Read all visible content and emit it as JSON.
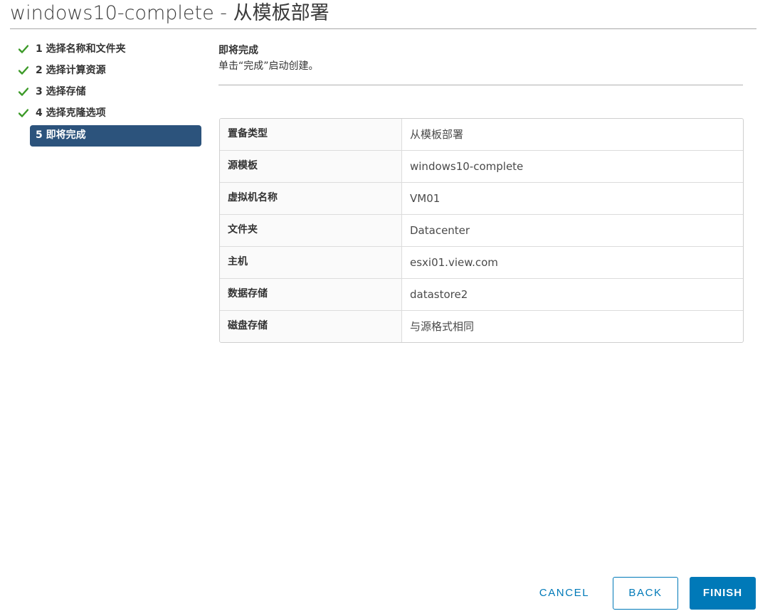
{
  "dialog": {
    "title": "windows10-complete - 从模板部署"
  },
  "steps": [
    {
      "label": "1 选择名称和文件夹",
      "completed": true,
      "icon": "checkmark-icon"
    },
    {
      "label": "2 选择计算资源",
      "completed": true,
      "icon": "checkmark-icon"
    },
    {
      "label": "3 选择存储",
      "completed": true,
      "icon": "checkmark-icon"
    },
    {
      "label": "4 选择克隆选项",
      "completed": true,
      "icon": "checkmark-icon"
    },
    {
      "label": "5 即将完成",
      "completed": false,
      "active": true
    }
  ],
  "main": {
    "heading": "即将完成",
    "description": "单击“完成”启动创建。",
    "summary": [
      {
        "key": "置备类型",
        "value": "从模板部署"
      },
      {
        "key": "源模板",
        "value": "windows10-complete"
      },
      {
        "key": "虚拟机名称",
        "value": "VM01"
      },
      {
        "key": "文件夹",
        "value": "Datacenter"
      },
      {
        "key": "主机",
        "value": "esxi01.view.com"
      },
      {
        "key": "数据存储",
        "value": "datastore2"
      },
      {
        "key": "磁盘存储",
        "value": "与源格式相同"
      }
    ]
  },
  "footer": {
    "cancel_label": "CANCEL",
    "back_label": "BACK",
    "finish_label": "FINISH"
  },
  "colors": {
    "check_green": "#3c9a28",
    "active_step_bg": "#2c537c",
    "primary_blue": "#0079b8"
  }
}
